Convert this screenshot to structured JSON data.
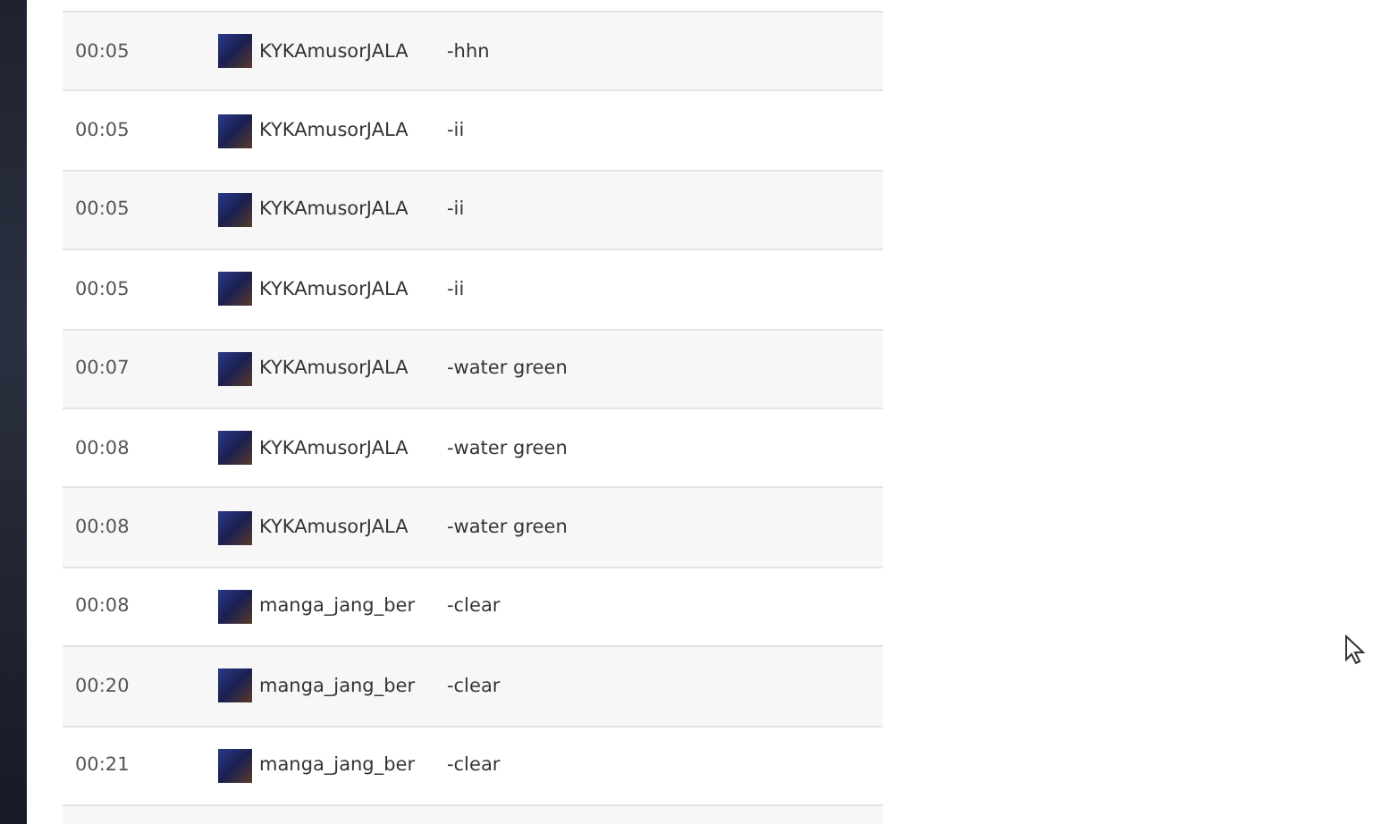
{
  "chat_log": {
    "rows": [
      {
        "time": "00:05",
        "user": "KYKAmusorJALA",
        "message": "-hhn"
      },
      {
        "time": "00:05",
        "user": "KYKAmusorJALA",
        "message": "-ii"
      },
      {
        "time": "00:05",
        "user": "KYKAmusorJALA",
        "message": "-ii"
      },
      {
        "time": "00:05",
        "user": "KYKAmusorJALA",
        "message": "-ii"
      },
      {
        "time": "00:07",
        "user": "KYKAmusorJALA",
        "message": "-water green"
      },
      {
        "time": "00:08",
        "user": "KYKAmusorJALA",
        "message": "-water green"
      },
      {
        "time": "00:08",
        "user": "KYKAmusorJALA",
        "message": "-water green"
      },
      {
        "time": "00:08",
        "user": "manga_jang_ber",
        "message": "-clear"
      },
      {
        "time": "00:20",
        "user": "manga_jang_ber",
        "message": "-clear"
      },
      {
        "time": "00:21",
        "user": "manga_jang_ber",
        "message": "-clear"
      }
    ]
  }
}
